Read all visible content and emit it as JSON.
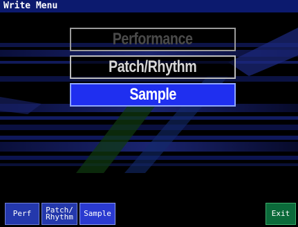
{
  "window": {
    "title": "Write Menu"
  },
  "menu": {
    "items": [
      {
        "label": "Performance",
        "state": "disabled"
      },
      {
        "label": "Patch/Rhythm",
        "state": "normal"
      },
      {
        "label": "Sample",
        "state": "selected"
      }
    ]
  },
  "function_buttons": {
    "perf": "Perf",
    "patch_rhythm_line1": "Patch/",
    "patch_rhythm_line2": "Rhythm",
    "sample": "Sample",
    "exit": "Exit"
  },
  "colors": {
    "title_bar": "#0c1a6e",
    "selected": "#1f2ff0",
    "function_button": "#2438ac",
    "exit_button": "#0b6a3a"
  }
}
